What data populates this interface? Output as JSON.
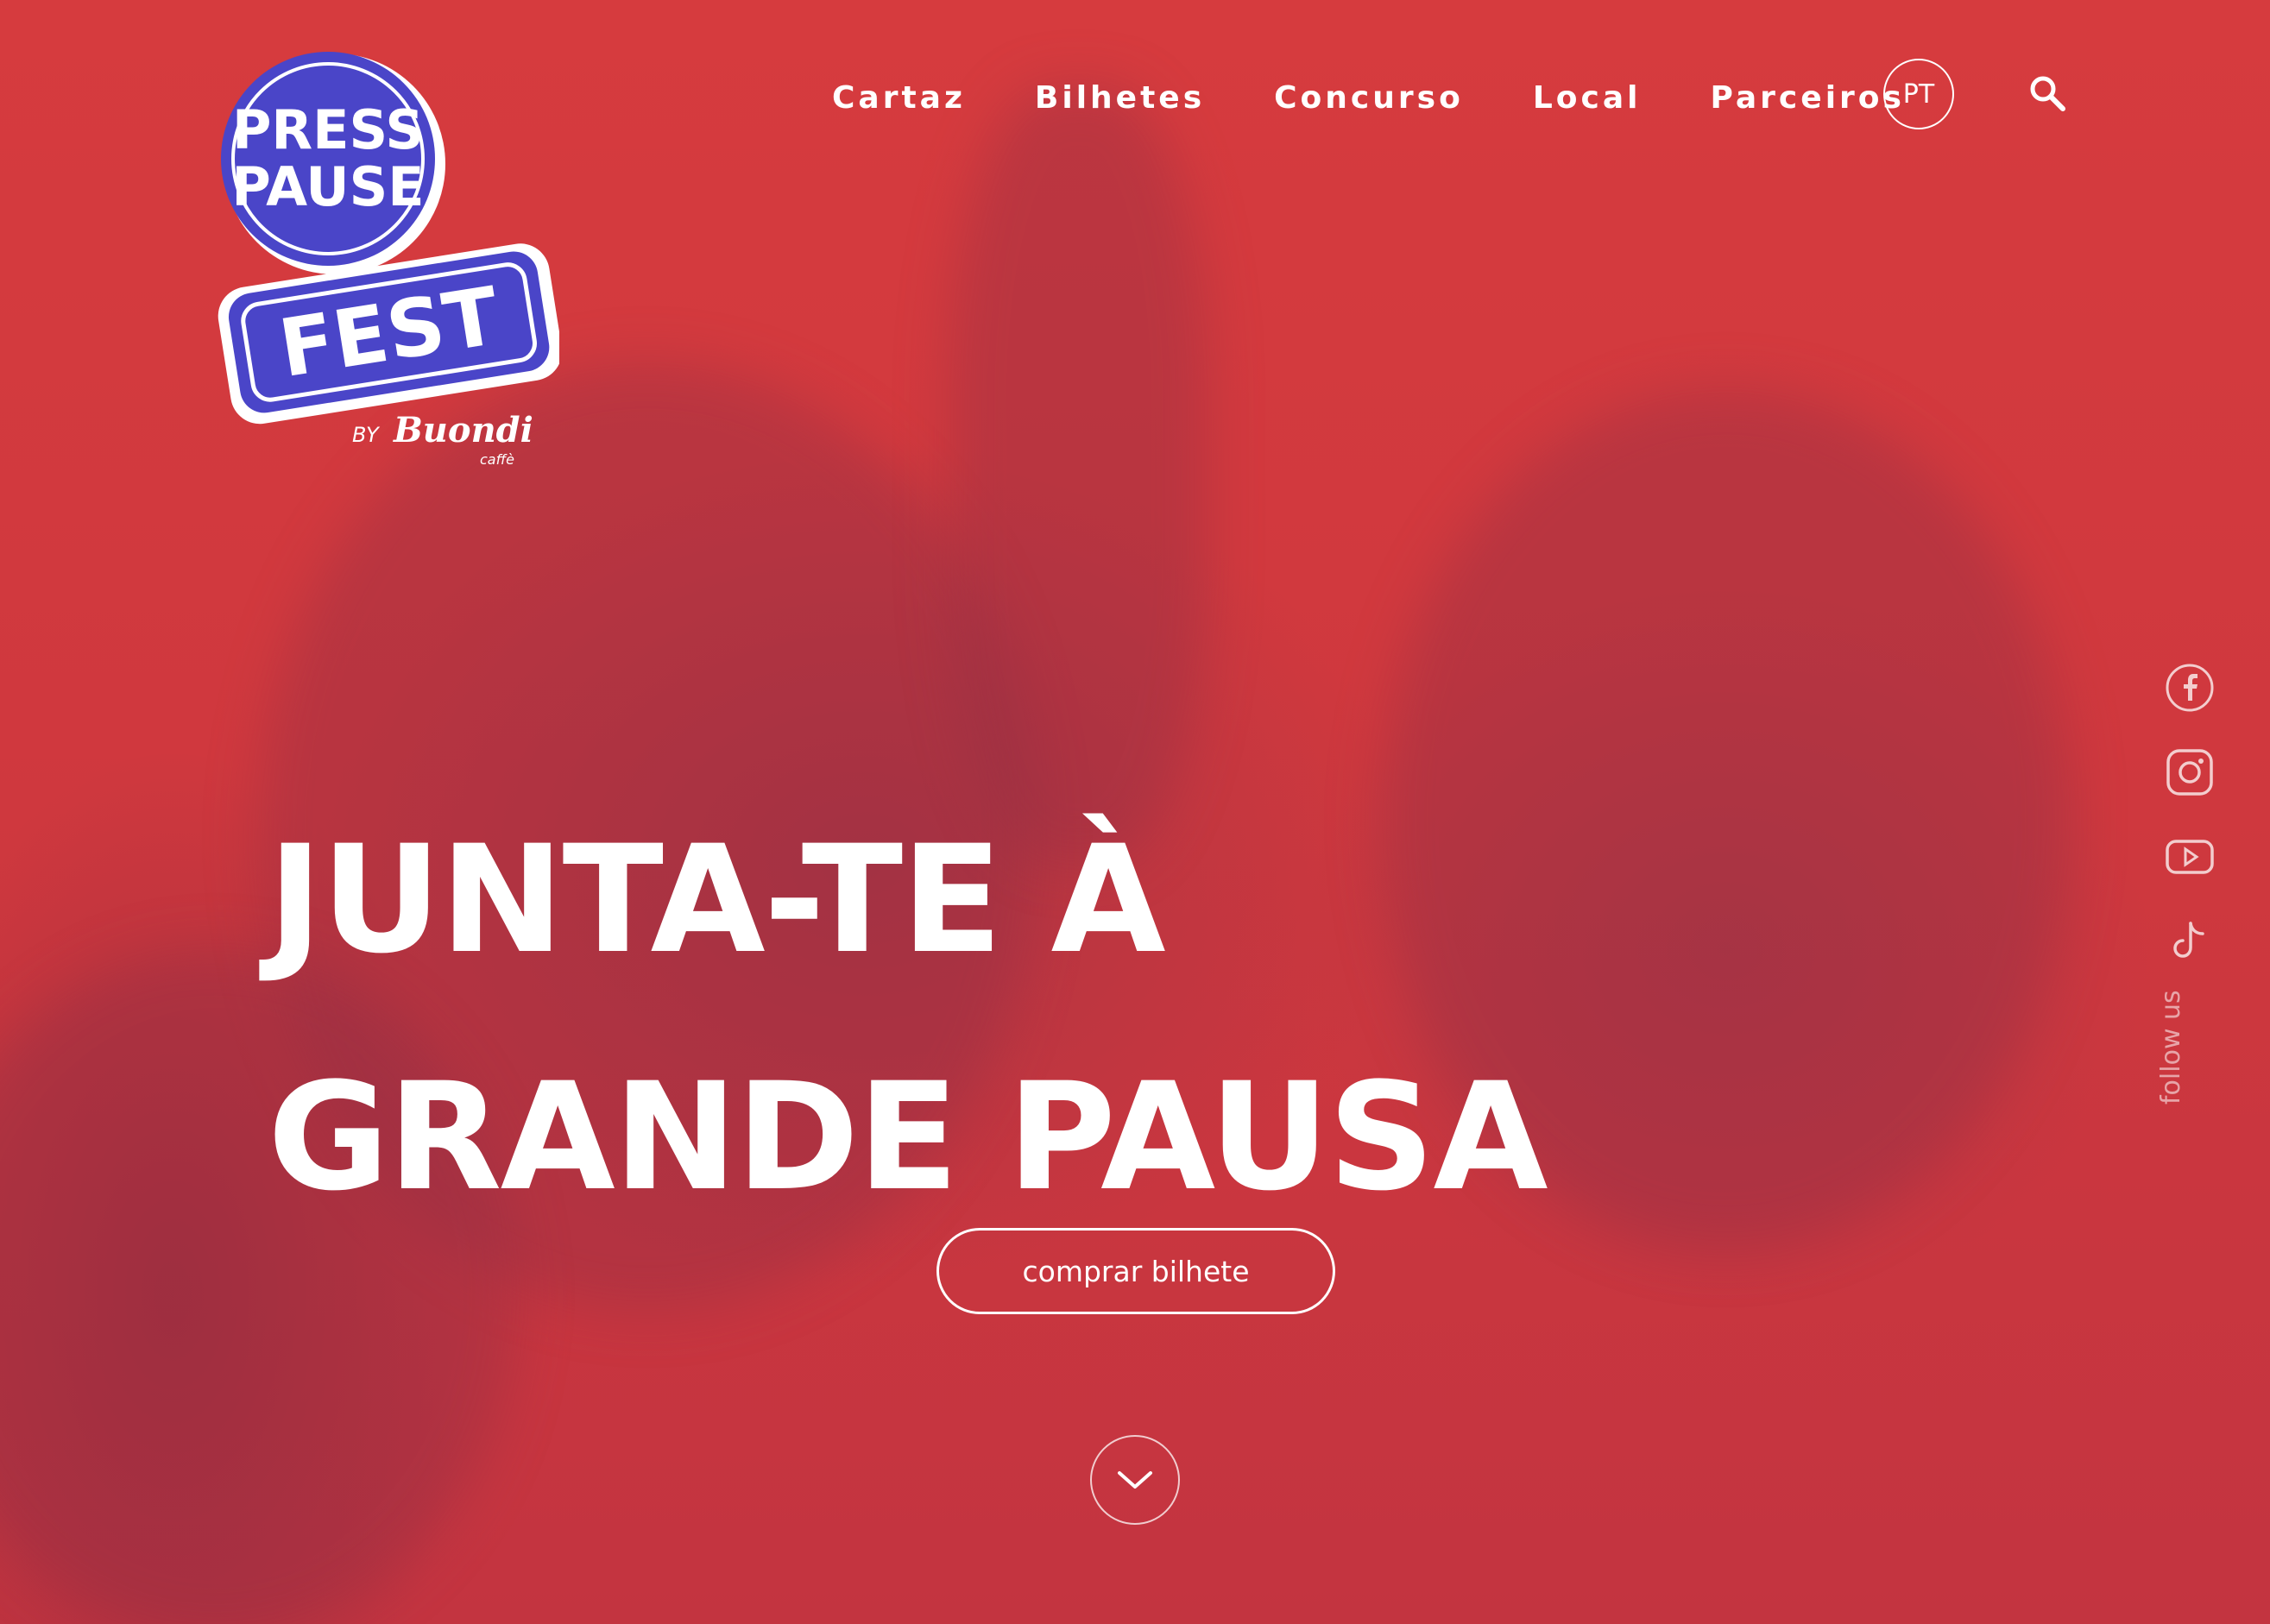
{
  "brand": {
    "logo_top_line": "PRESS",
    "logo_mid_line": "PAUSE",
    "logo_bottom_line": "FEST",
    "by_label": "BY",
    "sponsor": "Buondi",
    "sponsor_sub": "caffè",
    "logo_color": "#4a45c8"
  },
  "nav": {
    "items": [
      "Cartaz",
      "Bilhetes",
      "Concurso",
      "Local",
      "Parceiros"
    ],
    "language": "PT"
  },
  "hero": {
    "headline_line1": "JUNTA-TE À",
    "headline_line2": "GRANDE PAUSA",
    "cta_label": "comprar bilhete",
    "background_color": "#d63b3e"
  },
  "social": {
    "icons": [
      "facebook-icon",
      "instagram-icon",
      "youtube-icon",
      "tiktok-icon"
    ],
    "follow_label": "follow us"
  }
}
